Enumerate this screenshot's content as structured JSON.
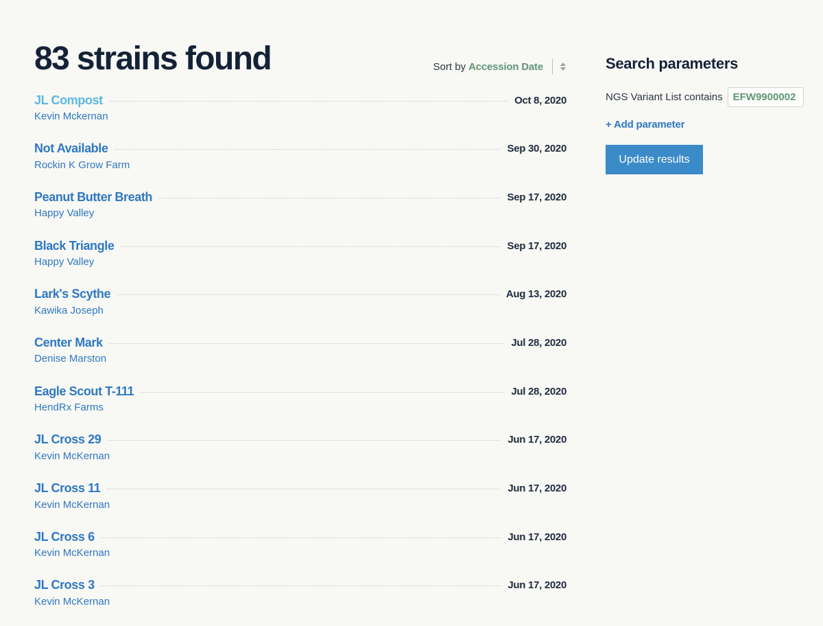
{
  "results": {
    "title": "83 strains found",
    "sort_label": "Sort by",
    "sort_value": "Accession Date"
  },
  "strains": [
    {
      "name": "JL Compost",
      "breeder": "Kevin Mckernan",
      "date": "Oct 8, 2020",
      "active": true
    },
    {
      "name": "Not Available",
      "breeder": "Rockin K Grow Farm",
      "date": "Sep 30, 2020"
    },
    {
      "name": "Peanut Butter Breath",
      "breeder": "Happy Valley",
      "date": "Sep 17, 2020"
    },
    {
      "name": "Black Triangle",
      "breeder": "Happy Valley",
      "date": "Sep 17, 2020"
    },
    {
      "name": "Lark's Scythe",
      "breeder": "Kawika Joseph",
      "date": "Aug 13, 2020"
    },
    {
      "name": "Center Mark",
      "breeder": "Denise Marston",
      "date": "Jul 28, 2020"
    },
    {
      "name": "Eagle Scout T-111",
      "breeder": "HendRx Farms",
      "date": "Jul 28, 2020"
    },
    {
      "name": "JL Cross 29",
      "breeder": "Kevin McKernan",
      "date": "Jun 17, 2020"
    },
    {
      "name": "JL Cross 11",
      "breeder": "Kevin McKernan",
      "date": "Jun 17, 2020"
    },
    {
      "name": "JL Cross 6",
      "breeder": "Kevin McKernan",
      "date": "Jun 17, 2020"
    },
    {
      "name": "JL Cross 3",
      "breeder": "Kevin McKernan",
      "date": "Jun 17, 2020"
    }
  ],
  "sidebar": {
    "title": "Search parameters",
    "param_label": "NGS Variant List contains",
    "param_value": "EFW9900002",
    "add_param_label": "+ Add parameter",
    "update_label": "Update results"
  },
  "colors": {
    "background": "#f8f8f4",
    "link": "#2e78c2",
    "link_active": "#5bb8e3",
    "accent_green": "#5f9675",
    "button": "#3b8bc9"
  }
}
